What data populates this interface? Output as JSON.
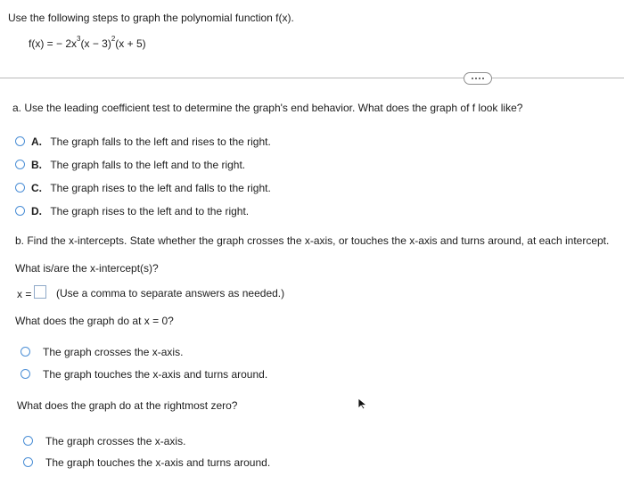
{
  "question": {
    "intro": "Use the following steps to graph the polynomial function f(x).",
    "formula": {
      "lhs": "f(x) = − 2x",
      "exp1": "3",
      "mid": "(x − 3)",
      "exp2": "2",
      "rhs": "(x + 5)"
    }
  },
  "part_a": {
    "prompt": "a. Use the leading coefficient test to determine the graph's end behavior. What does the graph of f look like?",
    "options": [
      {
        "letter": "A.",
        "text": "The graph falls to the left and rises to the right."
      },
      {
        "letter": "B.",
        "text": "The graph falls to the left and to the right."
      },
      {
        "letter": "C.",
        "text": "The graph rises to the left and falls to the right."
      },
      {
        "letter": "D.",
        "text": "The graph rises to the left and to the right."
      }
    ]
  },
  "part_b": {
    "prompt": "b. Find the x-intercepts. State whether the graph crosses the x-axis, or touches the x-axis and turns around, at each intercept.",
    "intercepts_question": "What is/are the x-intercept(s)?",
    "x_label": "x =",
    "answer_value": "",
    "hint": "(Use a comma to separate answers as needed.)",
    "zero_question": "What does the graph do at x = 0?",
    "zero_options": [
      "The graph crosses the x-axis.",
      "The graph touches the x-axis and turns around."
    ],
    "rightmost_question": "What does the graph do at the rightmost zero?",
    "rightmost_options": [
      "The graph crosses the x-axis.",
      "The graph touches the x-axis and turns around."
    ]
  },
  "ui": {
    "radio_color": "#4c8fd6",
    "more_icon": "ellipsis-icon",
    "cursor_icon": "mouse-pointer-icon"
  }
}
